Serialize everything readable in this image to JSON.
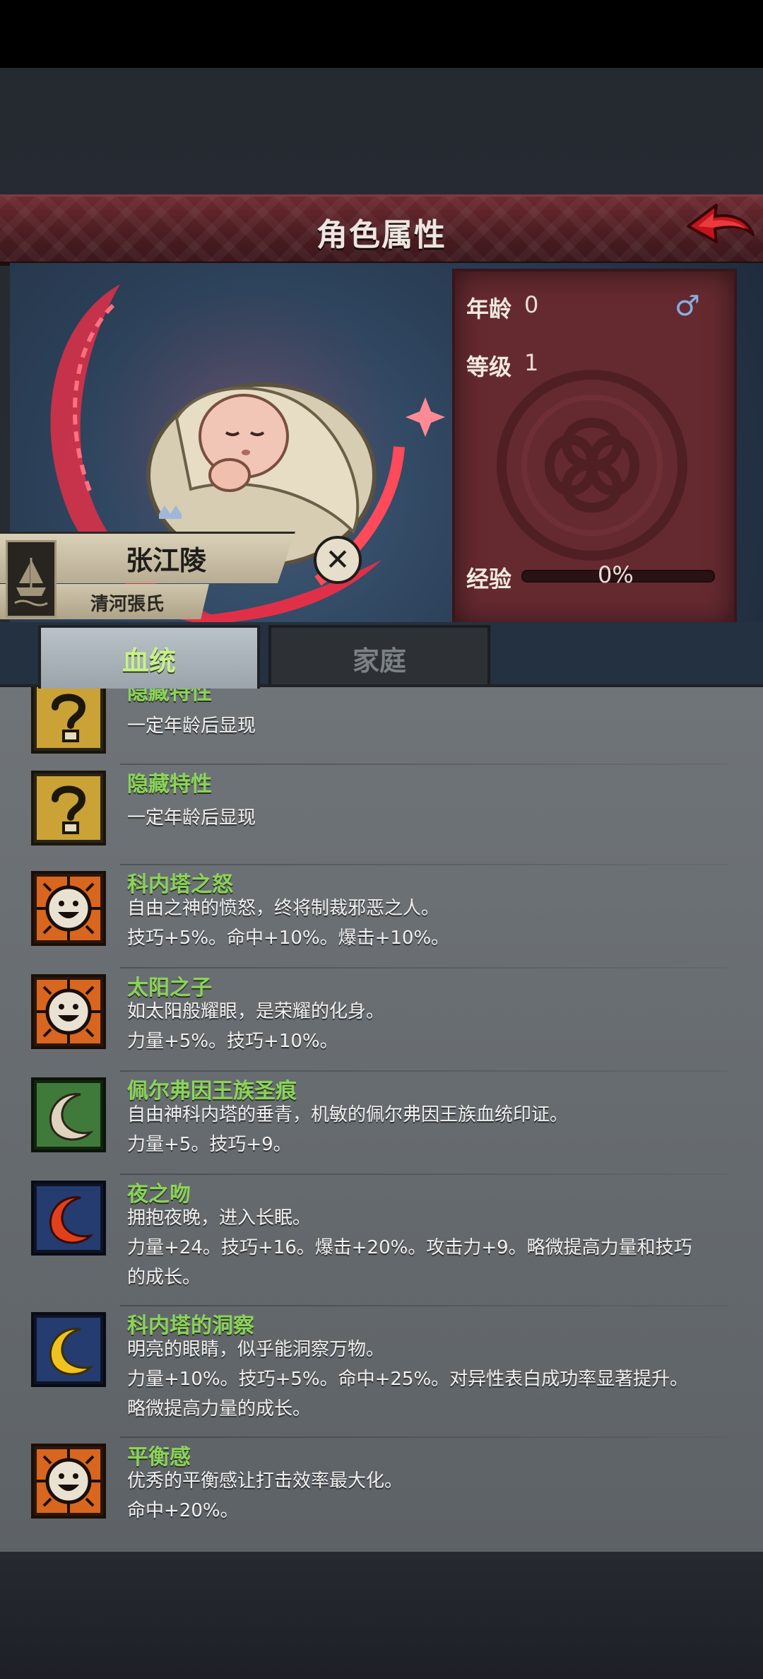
{
  "header": {
    "title": "角色属性"
  },
  "character": {
    "name": "张江陵",
    "clan": "清河張氏",
    "gender_icon": "male-icon",
    "stats": {
      "age_label": "年龄",
      "age_value": "0",
      "level_label": "等级",
      "level_value": "1",
      "exp_label": "经验",
      "exp_value": "0%",
      "exp_fraction": 0
    }
  },
  "tabs": [
    {
      "label": "血统",
      "active": true
    },
    {
      "label": "家庭",
      "active": false
    }
  ],
  "traits": [
    {
      "name": "隐藏特性",
      "desc": [
        "一定年龄后显现"
      ],
      "icon": "question-icon"
    },
    {
      "name": "隐藏特性",
      "desc": [
        "一定年龄后显现"
      ],
      "icon": "question-icon"
    },
    {
      "name": "科内塔之怒",
      "desc": [
        "自由之神的愤怒，终将制裁邪恶之人。",
        "技巧+5%。命中+10%。爆击+10%。"
      ],
      "icon": "smiley-icon"
    },
    {
      "name": "太阳之子",
      "desc": [
        "如太阳般耀眼，是荣耀的化身。",
        "力量+5%。技巧+10%。"
      ],
      "icon": "smiley-icon"
    },
    {
      "name": "佩尔弗因王族圣痕",
      "desc": [
        "自由神科内塔的垂青，机敏的佩尔弗因王族血统印证。",
        "力量+5。技巧+9。"
      ],
      "icon": "crescent-white-icon"
    },
    {
      "name": "夜之吻",
      "desc": [
        "拥抱夜晚，进入长眠。",
        "力量+24。技巧+16。爆击+20%。攻击力+9。略微提高力量和技巧",
        "的成长。"
      ],
      "icon": "crescent-red-icon"
    },
    {
      "name": "科内塔的洞察",
      "desc": [
        "明亮的眼睛，似乎能洞察万物。",
        "力量+10%。技巧+5%。命中+25%。对异性表白成功率显著提升。",
        "略微提高力量的成长。"
      ],
      "icon": "crescent-yellow-icon"
    },
    {
      "name": "平衡感",
      "desc": [
        "优秀的平衡感让打击效率最大化。",
        "命中+20%。"
      ],
      "icon": "smiley-icon"
    }
  ]
}
